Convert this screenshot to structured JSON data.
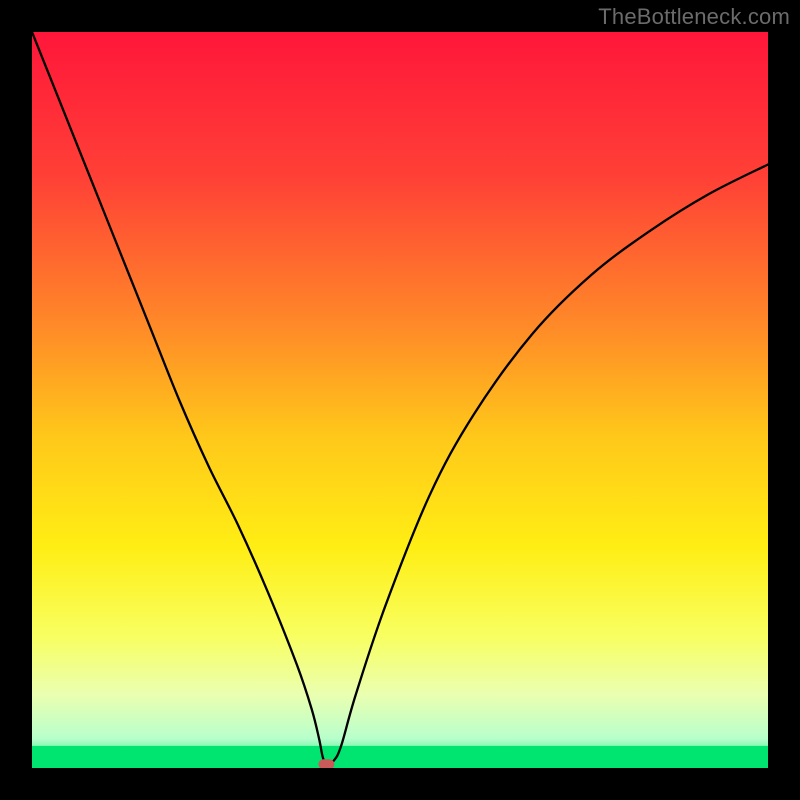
{
  "attribution": "TheBottleneck.com",
  "chart_data": {
    "type": "line",
    "title": "",
    "xlabel": "",
    "ylabel": "",
    "xlim": [
      0,
      100
    ],
    "ylim": [
      0,
      100
    ],
    "background_gradient": {
      "stops": [
        {
          "offset": 0.0,
          "color": "#ff163a"
        },
        {
          "offset": 0.2,
          "color": "#ff4136"
        },
        {
          "offset": 0.4,
          "color": "#ff8a28"
        },
        {
          "offset": 0.55,
          "color": "#ffc81a"
        },
        {
          "offset": 0.7,
          "color": "#ffee14"
        },
        {
          "offset": 0.82,
          "color": "#f8ff60"
        },
        {
          "offset": 0.9,
          "color": "#eaffb0"
        },
        {
          "offset": 0.96,
          "color": "#b8ffcc"
        },
        {
          "offset": 1.0,
          "color": "#00e56f"
        }
      ]
    },
    "green_band": {
      "y0": 97,
      "y1": 100
    },
    "curve": {
      "name": "bottleneck-curve",
      "x": [
        0,
        4,
        8,
        12,
        16,
        20,
        24,
        28,
        32,
        36,
        38,
        39,
        39.5,
        40,
        41,
        42,
        44,
        48,
        54,
        60,
        68,
        76,
        84,
        92,
        100
      ],
      "y": [
        100,
        90,
        80,
        70,
        60,
        50,
        41,
        33,
        24,
        14,
        8,
        4,
        1.5,
        0.5,
        1.0,
        3,
        10,
        22,
        37,
        48,
        59,
        67,
        73,
        78,
        82
      ]
    },
    "marker": {
      "x": 40,
      "y": 0.5,
      "color": "#c95a5a"
    }
  }
}
